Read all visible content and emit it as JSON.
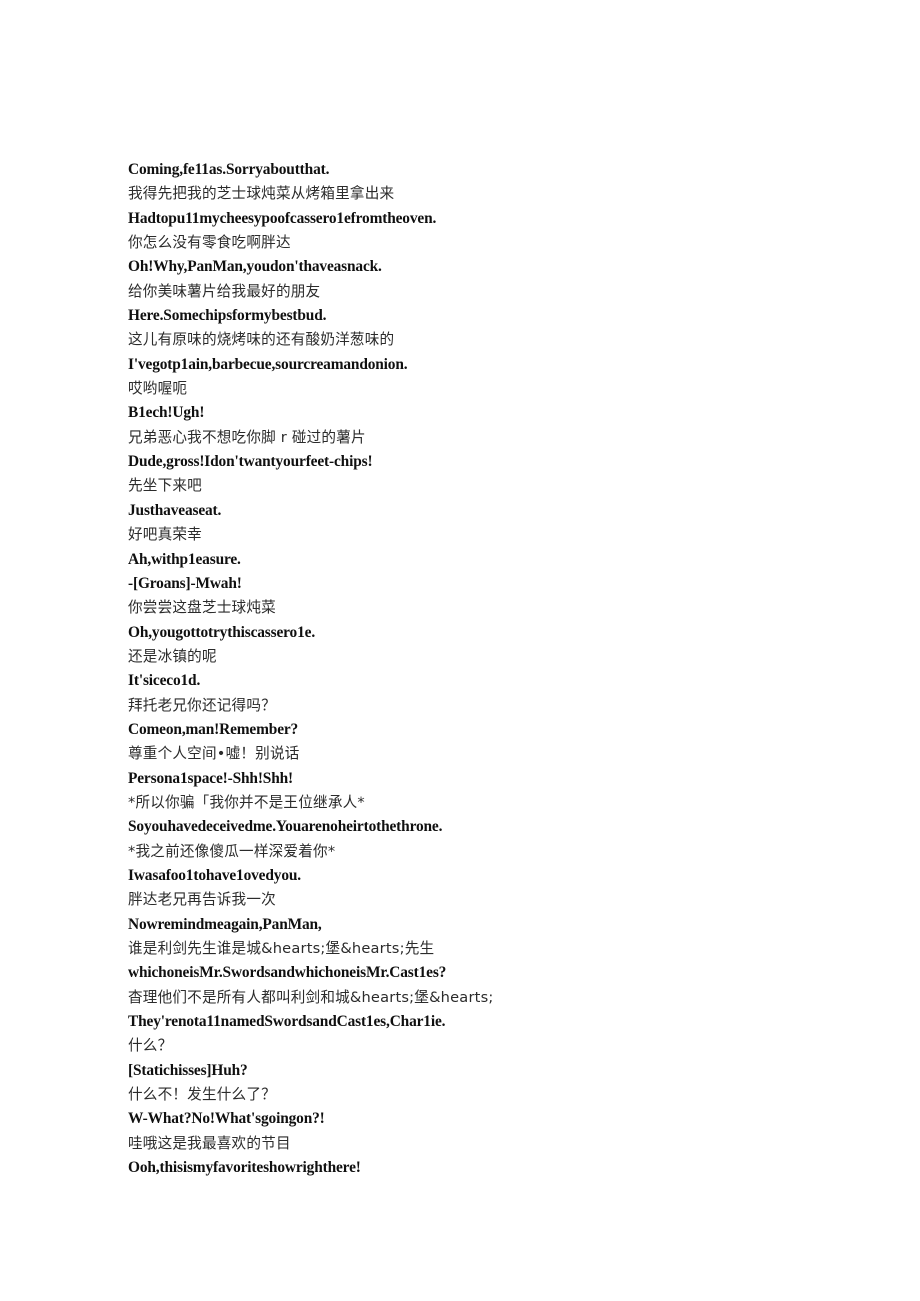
{
  "document": {
    "page_background": "#ffffff",
    "text_color": "#000000",
    "lines": [
      {
        "lang": "en",
        "text": "Coming,fe11as.Sorryaboutthat."
      },
      {
        "lang": "zh",
        "text": "我得先把我的芝士球炖菜从烤箱里拿出来"
      },
      {
        "lang": "en",
        "text": "Hadtopu11mycheesypoofcassero1efromtheoven."
      },
      {
        "lang": "zh",
        "text": "你怎么没有零食吃啊胖达"
      },
      {
        "lang": "en",
        "text": "Oh!Why,PanMan,youdon'thaveasnack."
      },
      {
        "lang": "zh",
        "text": "给你美味薯片给我最好的朋友"
      },
      {
        "lang": "en",
        "text": "Here.Somechipsformybestbud."
      },
      {
        "lang": "zh",
        "text": "这儿有原味的烧烤味的还有酸奶洋葱味的"
      },
      {
        "lang": "en",
        "text": "I'vegotp1ain,barbecue,sourcreamandonion."
      },
      {
        "lang": "zh",
        "text": "哎哟喔呃"
      },
      {
        "lang": "en",
        "text": "B1ech!Ugh!"
      },
      {
        "lang": "zh",
        "text": "兄弟恶心我不想吃你脚 r 碰过的薯片"
      },
      {
        "lang": "en",
        "text": "Dude,gross!Idon'twantyourfeet-chips!"
      },
      {
        "lang": "zh",
        "text": "先坐下来吧"
      },
      {
        "lang": "en",
        "text": "Justhaveaseat."
      },
      {
        "lang": "zh",
        "text": "好吧真荣幸"
      },
      {
        "lang": "en",
        "text": "Ah,withp1easure."
      },
      {
        "lang": "en",
        "text": "-[Groans]-Mwah!"
      },
      {
        "lang": "zh",
        "text": "你尝尝这盘芝士球炖菜"
      },
      {
        "lang": "en",
        "text": "Oh,yougottotrythiscassero1e."
      },
      {
        "lang": "zh",
        "text": "还是冰镇的呢"
      },
      {
        "lang": "en",
        "text": "It'siceco1d."
      },
      {
        "lang": "zh",
        "text": "拜托老兄你还记得吗？"
      },
      {
        "lang": "en",
        "text": "Comeon,man!Remember?"
      },
      {
        "lang": "zh",
        "text": "尊重个人空间•嘘！别说话"
      },
      {
        "lang": "en",
        "text": "Persona1space!-Shh!Shh!"
      },
      {
        "lang": "zh",
        "text": "*所以你骗「我你并不是王位继承人*"
      },
      {
        "lang": "en",
        "text": "Soyouhavedeceivedme.Youarenoheirtothethrone."
      },
      {
        "lang": "zh",
        "text": "*我之前还像傻瓜一样深爱着你*"
      },
      {
        "lang": "en",
        "text": "Iwasafoo1tohave1ovedyou."
      },
      {
        "lang": "zh",
        "text": "胖达老兄再告诉我一次"
      },
      {
        "lang": "en",
        "text": "Nowremindmeagain,PanMan,"
      },
      {
        "lang": "zh",
        "text": "谁是利剑先生谁是城&hearts;堡&hearts;先生"
      },
      {
        "lang": "en",
        "text": "whichoneisMr.SwordsandwhichoneisMr.Cast1es?"
      },
      {
        "lang": "zh",
        "text": "杳理他们不是所有人都叫利剑和城&hearts;堡&hearts;"
      },
      {
        "lang": "en",
        "text": "They'renota11namedSwordsandCast1es,Char1ie."
      },
      {
        "lang": "zh",
        "text": "什么？"
      },
      {
        "lang": "en",
        "text": "[Statichisses]Huh?"
      },
      {
        "lang": "zh",
        "text": "什么不！发生什么了？"
      },
      {
        "lang": "en",
        "text": "W-What?No!What'sgoingon?!"
      },
      {
        "lang": "zh",
        "text": "哇哦这是我最喜欢的节目"
      },
      {
        "lang": "en",
        "text": "Ooh,thisismyfavoriteshowrighthere!"
      }
    ]
  }
}
